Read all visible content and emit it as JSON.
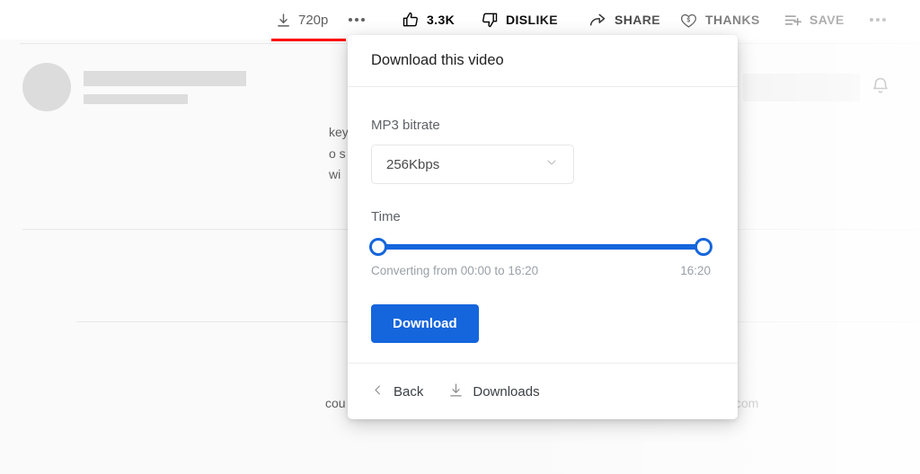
{
  "toolbar": {
    "quality_label": "720p",
    "download_icon": "download-icon",
    "more_icon": "more-dots-icon",
    "like_label": "3.3K",
    "like_icon": "thumbs-up-icon",
    "dislike_label": "DISLIKE",
    "dislike_icon": "thumbs-down-icon",
    "share_label": "SHARE",
    "share_icon": "share-arrow-icon",
    "thanks_label": "THANKS",
    "thanks_icon": "heart-dollar-icon",
    "save_label": "SAVE",
    "save_icon": "playlist-add-icon",
    "overflow_icon": "more-dots-icon"
  },
  "background": {
    "progress_color": "#ff0000",
    "bell_icon": "notification-bell-icon",
    "partial_text_left": "cou",
    "partial_text_right": "com",
    "partial_text_block": [
      "key",
      "o s",
      "wi"
    ]
  },
  "dialog": {
    "title": "Download this video",
    "bitrate": {
      "label": "MP3 bitrate",
      "value": "256Kbps",
      "chevron_icon": "chevron-down-icon"
    },
    "time": {
      "label": "Time",
      "status": "Converting from 00:00 to 16:20",
      "duration": "16:20",
      "start_percent": 0,
      "end_percent": 100,
      "track_color": "#1565dc"
    },
    "download_button": "Download",
    "footer": {
      "back_label": "Back",
      "back_icon": "chevron-left-icon",
      "downloads_label": "Downloads",
      "downloads_icon": "download-icon"
    }
  }
}
